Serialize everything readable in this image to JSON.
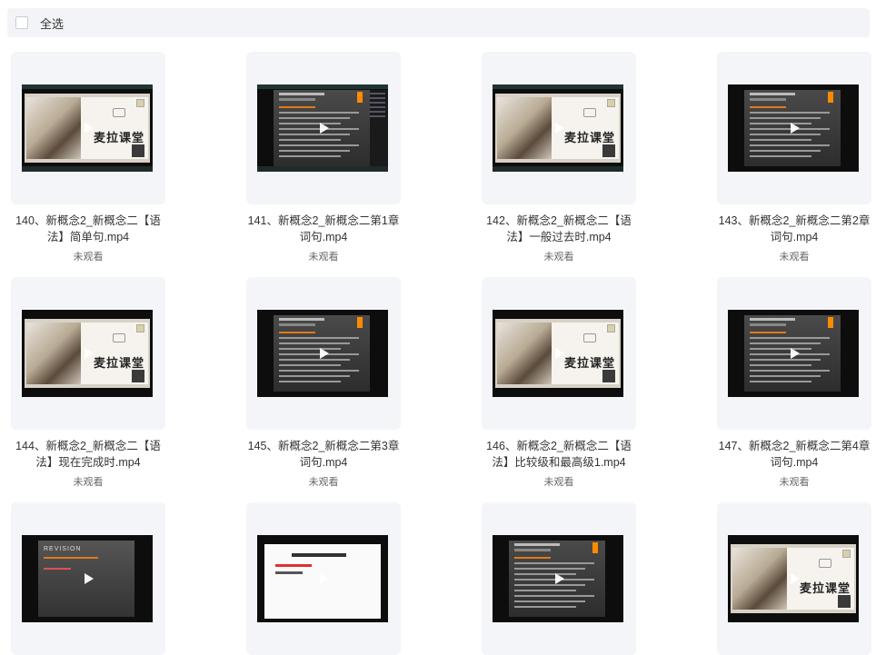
{
  "toolbar": {
    "select_all_label": "全选"
  },
  "cards": [
    {
      "title": "140、新概念2_新概念二【语法】简单句.mp4",
      "status": "未观看",
      "thumb": "cream-player"
    },
    {
      "title": "141、新概念2_新概念二第1章词句.mp4",
      "status": "未观看",
      "thumb": "dark-player"
    },
    {
      "title": "142、新概念2_新概念二【语法】一般过去时.mp4",
      "status": "未观看",
      "thumb": "cream-player"
    },
    {
      "title": "143、新概念2_新概念二第2章词句.mp4",
      "status": "未观看",
      "thumb": "dark"
    },
    {
      "title": "144、新概念2_新概念二【语法】现在完成时.mp4",
      "status": "未观看",
      "thumb": "cream"
    },
    {
      "title": "145、新概念2_新概念二第3章词句.mp4",
      "status": "未观看",
      "thumb": "dark"
    },
    {
      "title": "146、新概念2_新概念二【语法】比较级和最高级1.mp4",
      "status": "未观看",
      "thumb": "cream"
    },
    {
      "title": "147、新概念2_新概念二第4章词句.mp4",
      "status": "未观看",
      "thumb": "dark"
    },
    {
      "title": "",
      "status": "",
      "thumb": "revision"
    },
    {
      "title": "",
      "status": "",
      "thumb": "white"
    },
    {
      "title": "",
      "status": "",
      "thumb": "dark"
    },
    {
      "title": "",
      "status": "",
      "thumb": "cream"
    }
  ],
  "thumb_text": {
    "brand": "麦拉课堂",
    "revision": "REVISION"
  }
}
